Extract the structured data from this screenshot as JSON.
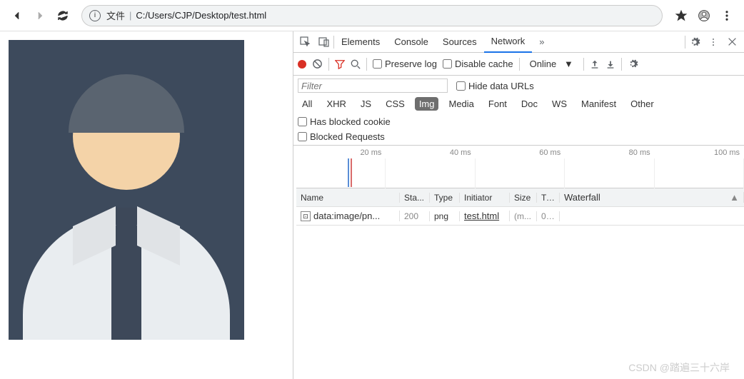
{
  "toolbar": {
    "file_label": "文件",
    "url_path": "C:/Users/CJP/Desktop/test.html"
  },
  "devtools": {
    "tabs": [
      "Elements",
      "Console",
      "Sources",
      "Network"
    ],
    "active_tab": "Network",
    "controls": {
      "preserve_log": "Preserve log",
      "disable_cache": "Disable cache",
      "throttling": "Online"
    },
    "filter": {
      "placeholder": "Filter",
      "hide_data_urls": "Hide data URLs",
      "types": [
        "All",
        "XHR",
        "JS",
        "CSS",
        "Img",
        "Media",
        "Font",
        "Doc",
        "WS",
        "Manifest",
        "Other"
      ],
      "selected_type": "Img",
      "has_blocked": "Has blocked cookie",
      "blocked_requests": "Blocked Requests"
    },
    "timeline": {
      "ticks": [
        "20 ms",
        "40 ms",
        "60 ms",
        "80 ms",
        "100 ms"
      ]
    },
    "columns": {
      "name": "Name",
      "status": "Sta...",
      "type": "Type",
      "initiator": "Initiator",
      "size": "Size",
      "time": "Ti...",
      "waterfall": "Waterfall"
    },
    "rows": [
      {
        "name": "data:image/pn...",
        "status": "200",
        "type": "png",
        "initiator": "test.html",
        "size": "(m...",
        "time": "0 ..."
      }
    ]
  },
  "watermark": "CSDN @踏遍三十六岸"
}
